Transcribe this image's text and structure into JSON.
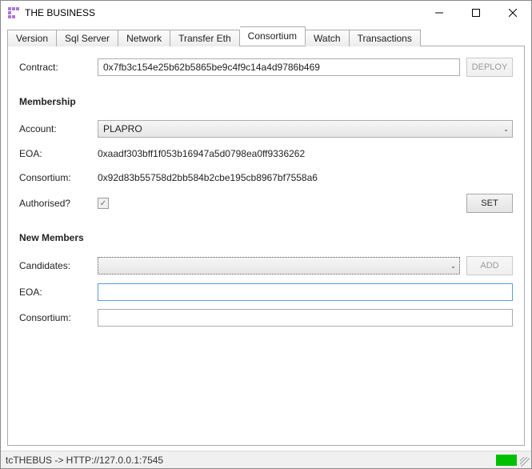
{
  "window": {
    "title": "THE BUSINESS"
  },
  "tabs": [
    {
      "label": "Version"
    },
    {
      "label": "Sql Server"
    },
    {
      "label": "Network"
    },
    {
      "label": "Transfer Eth"
    },
    {
      "label": "Consortium",
      "active": true
    },
    {
      "label": "Watch"
    },
    {
      "label": "Transactions"
    }
  ],
  "contract": {
    "label": "Contract:",
    "value": "0x7fb3c154e25b62b5865be9c4f9c14a4d9786b469",
    "deploy_label": "DEPLOY"
  },
  "membership": {
    "heading": "Membership",
    "account_label": "Account:",
    "account_value": "PLAPRO",
    "eoa_label": "EOA:",
    "eoa_value": "0xaadf303bff1f053b16947a5d0798ea0ff9336262",
    "consortium_label": "Consortium:",
    "consortium_value": "0x92d83b55758d2bb584b2cbe195cb8967bf7558a6",
    "authorised_label": "Authorised?",
    "authorised_checked": true,
    "set_label": "SET"
  },
  "new_members": {
    "heading": "New Members",
    "candidates_label": "Candidates:",
    "candidates_value": "",
    "add_label": "ADD",
    "eoa_label": "EOA:",
    "eoa_value": "",
    "consortium_label": "Consortium:",
    "consortium_value": ""
  },
  "status": {
    "text": "tcTHEBUS -> HTTP://127.0.0.1:7545"
  }
}
